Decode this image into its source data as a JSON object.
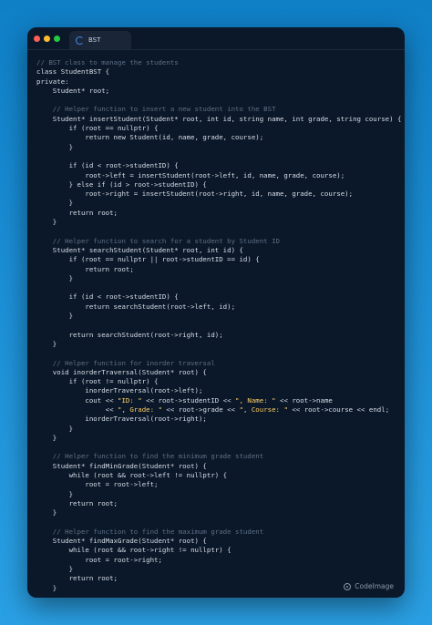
{
  "window": {
    "tab_label": "BST"
  },
  "code_lines": [
    {
      "text": "// BST class to manage the students",
      "kind": "comment"
    },
    {
      "text": "class StudentBST {",
      "kind": "code"
    },
    {
      "text": "private:",
      "kind": "code"
    },
    {
      "text": "    Student* root;",
      "kind": "code"
    },
    {
      "text": "",
      "kind": "blank"
    },
    {
      "text": "    // Helper function to insert a new student into the BST",
      "kind": "comment"
    },
    {
      "text": "    Student* insertStudent(Student* root, int id, string name, int grade, string course) {",
      "kind": "code"
    },
    {
      "text": "        if (root == nullptr) {",
      "kind": "code"
    },
    {
      "text": "            return new Student(id, name, grade, course);",
      "kind": "code"
    },
    {
      "text": "        }",
      "kind": "code"
    },
    {
      "text": "",
      "kind": "blank"
    },
    {
      "text": "        if (id < root->studentID) {",
      "kind": "code"
    },
    {
      "text": "            root->left = insertStudent(root->left, id, name, grade, course);",
      "kind": "code"
    },
    {
      "text": "        } else if (id > root->studentID) {",
      "kind": "code"
    },
    {
      "text": "            root->right = insertStudent(root->right, id, name, grade, course);",
      "kind": "code"
    },
    {
      "text": "        }",
      "kind": "code"
    },
    {
      "text": "        return root;",
      "kind": "code"
    },
    {
      "text": "    }",
      "kind": "code"
    },
    {
      "text": "",
      "kind": "blank"
    },
    {
      "text": "    // Helper function to search for a student by Student ID",
      "kind": "comment"
    },
    {
      "text": "    Student* searchStudent(Student* root, int id) {",
      "kind": "code"
    },
    {
      "text": "        if (root == nullptr || root->studentID == id) {",
      "kind": "code"
    },
    {
      "text": "            return root;",
      "kind": "code"
    },
    {
      "text": "        }",
      "kind": "code"
    },
    {
      "text": "",
      "kind": "blank"
    },
    {
      "text": "        if (id < root->studentID) {",
      "kind": "code"
    },
    {
      "text": "            return searchStudent(root->left, id);",
      "kind": "code"
    },
    {
      "text": "        }",
      "kind": "code"
    },
    {
      "text": "",
      "kind": "blank"
    },
    {
      "text": "        return searchStudent(root->right, id);",
      "kind": "code"
    },
    {
      "text": "    }",
      "kind": "code"
    },
    {
      "text": "",
      "kind": "blank"
    },
    {
      "text": "    // Helper function for inorder traversal",
      "kind": "comment"
    },
    {
      "text": "    void inorderTraversal(Student* root) {",
      "kind": "code"
    },
    {
      "text": "        if (root != nullptr) {",
      "kind": "code"
    },
    {
      "text": "            inorderTraversal(root->left);",
      "kind": "code"
    },
    {
      "text": "            cout << \"ID: \" << root->studentID << \", Name: \" << root->name",
      "kind": "code"
    },
    {
      "text": "                 << \", Grade: \" << root->grade << \", Course: \" << root->course << endl;",
      "kind": "code"
    },
    {
      "text": "            inorderTraversal(root->right);",
      "kind": "code"
    },
    {
      "text": "        }",
      "kind": "code"
    },
    {
      "text": "    }",
      "kind": "code"
    },
    {
      "text": "",
      "kind": "blank"
    },
    {
      "text": "    // Helper function to find the minimum grade student",
      "kind": "comment"
    },
    {
      "text": "    Student* findMinGrade(Student* root) {",
      "kind": "code"
    },
    {
      "text": "        while (root && root->left != nullptr) {",
      "kind": "code"
    },
    {
      "text": "            root = root->left;",
      "kind": "code"
    },
    {
      "text": "        }",
      "kind": "code"
    },
    {
      "text": "        return root;",
      "kind": "code"
    },
    {
      "text": "    }",
      "kind": "code"
    },
    {
      "text": "",
      "kind": "blank"
    },
    {
      "text": "    // Helper function to find the maximum grade student",
      "kind": "comment"
    },
    {
      "text": "    Student* findMaxGrade(Student* root) {",
      "kind": "code"
    },
    {
      "text": "        while (root && root->right != nullptr) {",
      "kind": "code"
    },
    {
      "text": "            root = root->right;",
      "kind": "code"
    },
    {
      "text": "        }",
      "kind": "code"
    },
    {
      "text": "        return root;",
      "kind": "code"
    },
    {
      "text": "    }",
      "kind": "code"
    }
  ],
  "footer": {
    "brand": "CodeImage"
  }
}
